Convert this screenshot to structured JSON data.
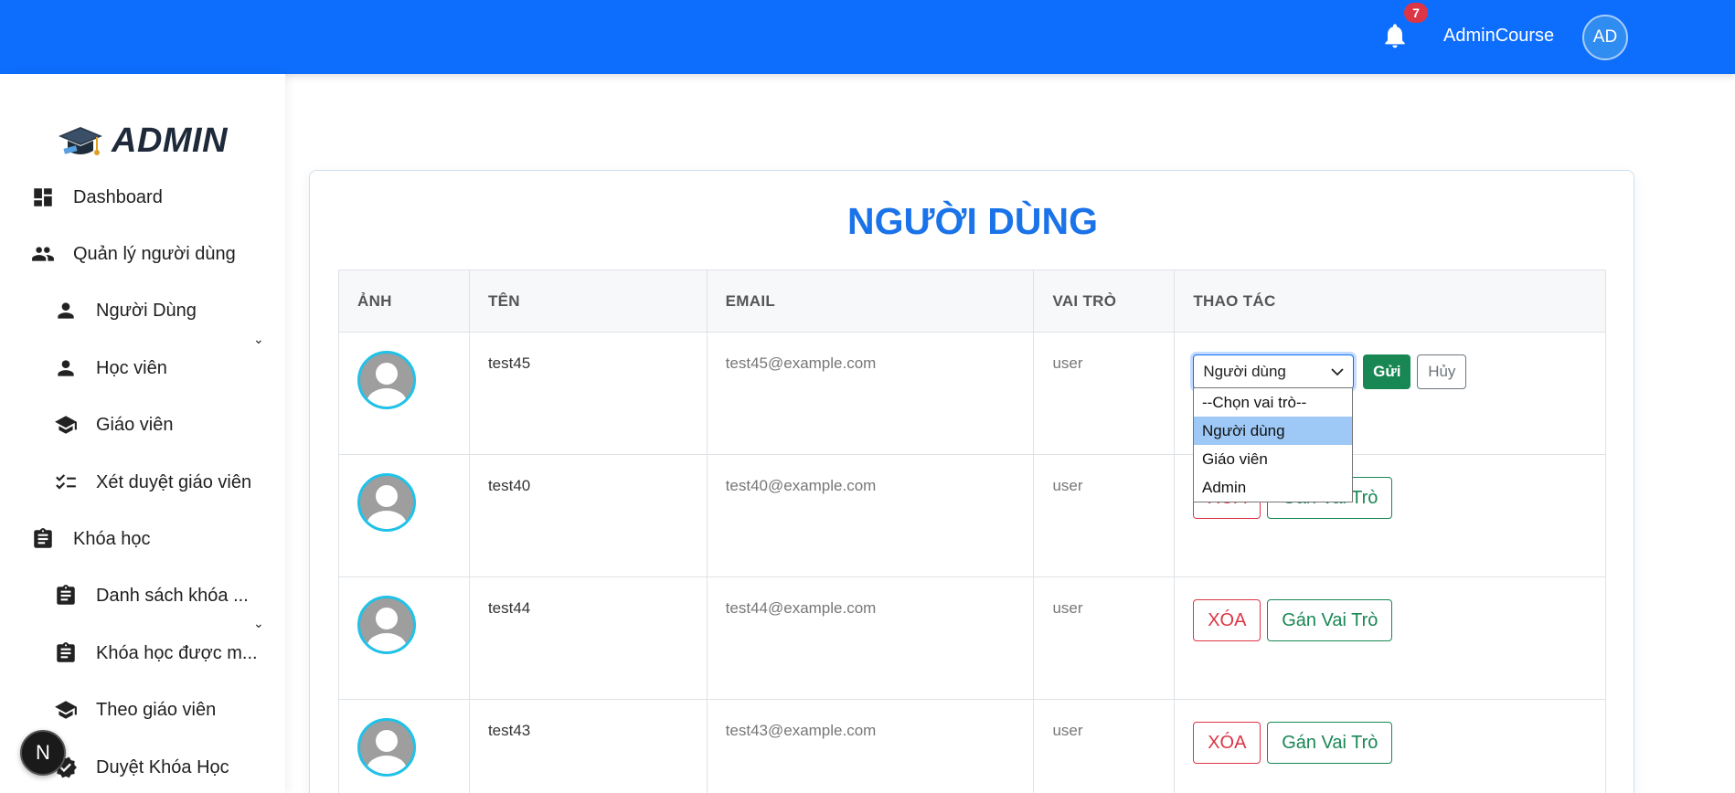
{
  "header": {
    "notification_count": "7",
    "admin_name": "AdminCourse",
    "avatar_initials": "AD",
    "brand_color": "#0d6efd"
  },
  "sidebar": {
    "logo_text": "ADMIN",
    "items": [
      {
        "label": "Dashboard",
        "icon": "dashboard-icon"
      },
      {
        "label": "Quản lý người dùng",
        "icon": "people-icon",
        "expandable": true
      },
      {
        "label": "Người Dùng",
        "icon": "person-icon"
      },
      {
        "label": "Học viên",
        "icon": "person-icon"
      },
      {
        "label": "Giáo viên",
        "icon": "school-icon"
      },
      {
        "label": "Xét duyệt giáo viên",
        "icon": "checklist-icon"
      },
      {
        "label": "Khóa học",
        "icon": "clipboard-icon",
        "expandable": true
      },
      {
        "label": "Danh sách khóa ...",
        "icon": "clipboard-icon"
      },
      {
        "label": "Khóa học được m...",
        "icon": "clipboard-icon"
      },
      {
        "label": "Theo giáo viên",
        "icon": "school-icon"
      },
      {
        "label": "Duyệt Khóa Học",
        "icon": "verified-icon"
      }
    ]
  },
  "fab": {
    "label": "N"
  },
  "main": {
    "title": "NGƯỜI DÙNG",
    "columns": [
      "ẢNH",
      "TÊN",
      "EMAIL",
      "VAI TRÒ",
      "THAO TÁC"
    ],
    "rows": [
      {
        "name": "test45",
        "email": "test45@example.com",
        "role": "user",
        "editing": true
      },
      {
        "name": "test40",
        "email": "test40@example.com",
        "role": "user"
      },
      {
        "name": "test44",
        "email": "test44@example.com",
        "role": "user"
      },
      {
        "name": "test43",
        "email": "test43@example.com",
        "role": "user"
      }
    ],
    "actions": {
      "delete_label": "XÓA",
      "assign_label": "Gán Vai Trò",
      "send_label": "Gửi",
      "cancel_label": "Hủy",
      "assign_label_partial": "Trò"
    },
    "role_select": {
      "selected": "Người dùng",
      "options": [
        "--Chọn vai trò--",
        "Người dùng",
        "Giáo viên",
        "Admin"
      ],
      "highlighted_index": 1
    }
  }
}
